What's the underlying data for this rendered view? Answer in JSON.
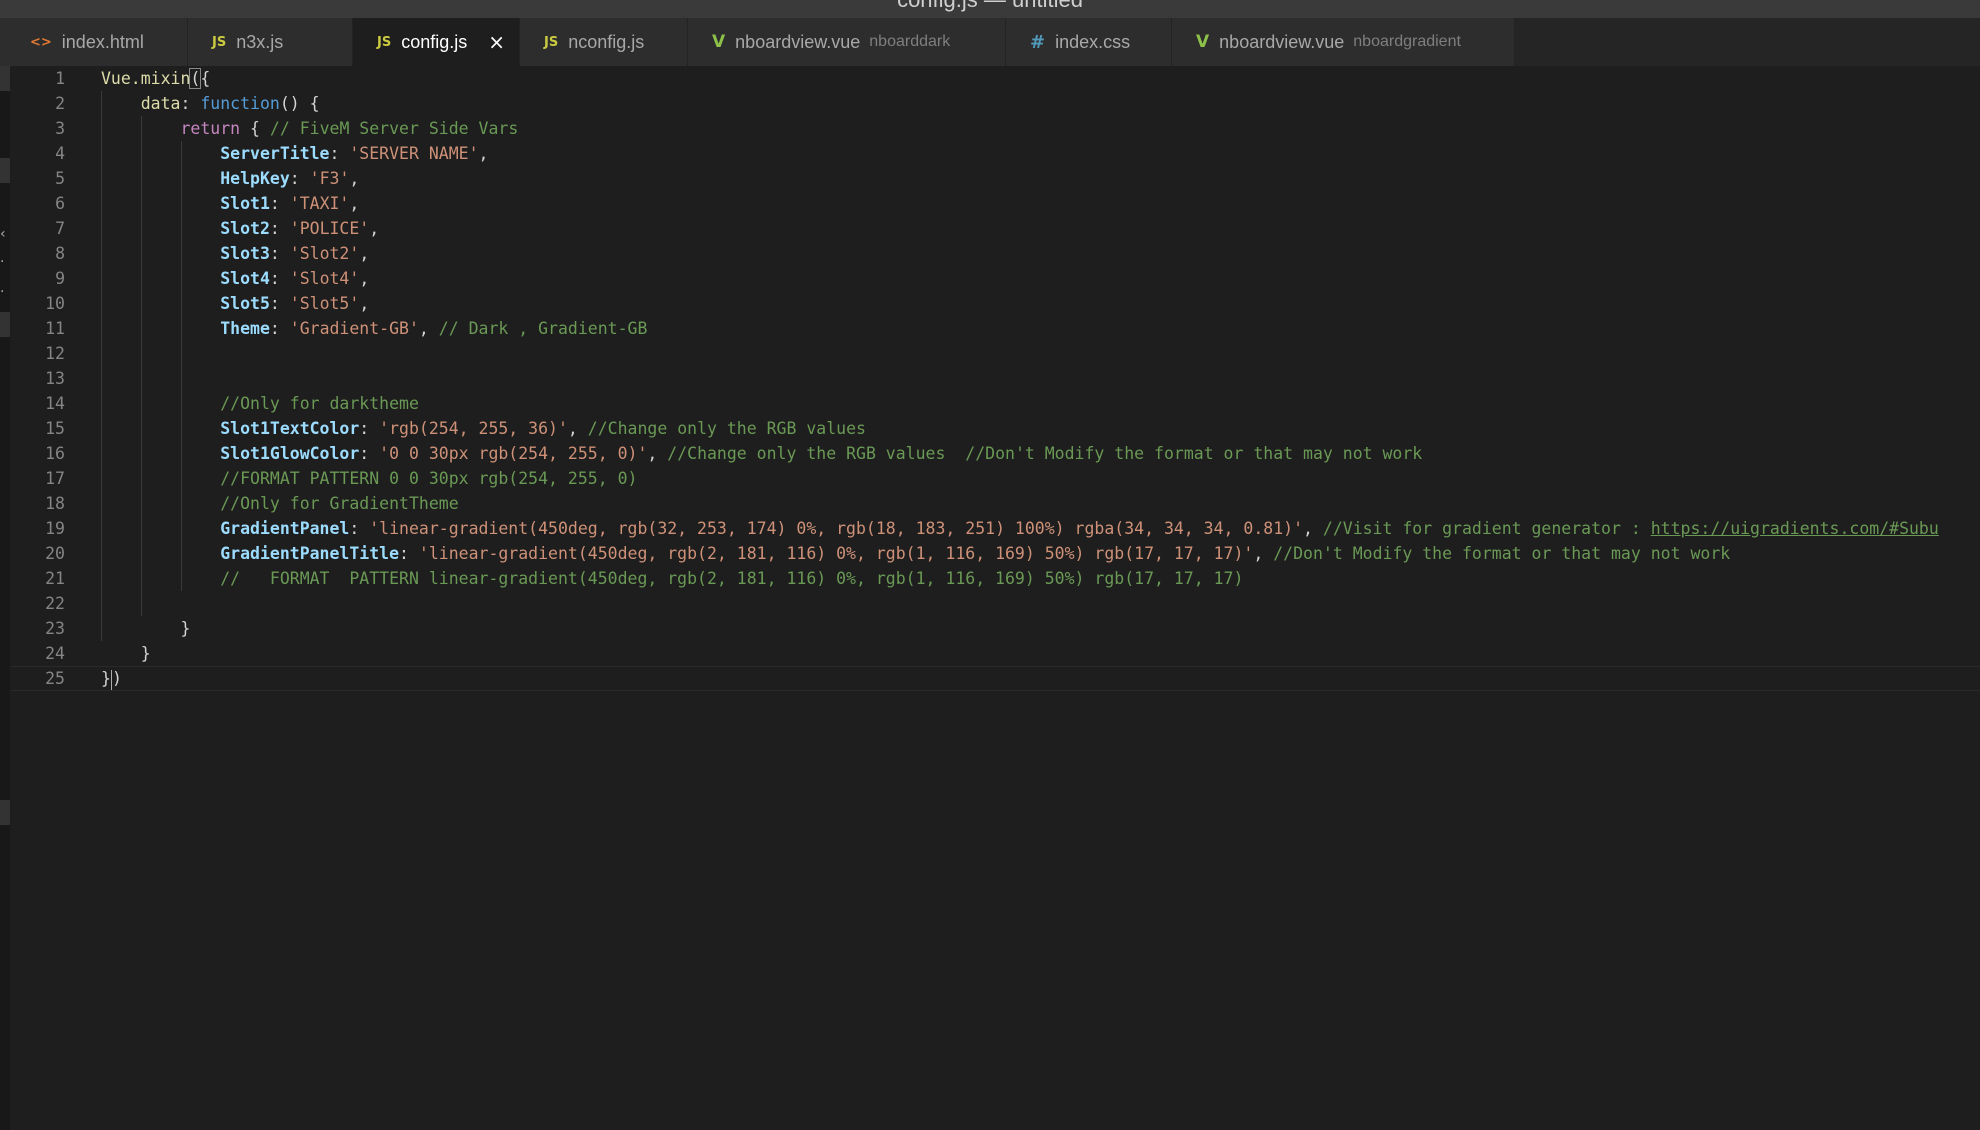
{
  "window": {
    "title": "config.js — untitled"
  },
  "tabs": [
    {
      "label": "index.html",
      "icon": "<>",
      "type": "html",
      "sub": "",
      "active": false
    },
    {
      "label": "n3x.js",
      "icon": "JS",
      "type": "js",
      "sub": "",
      "active": false
    },
    {
      "label": "config.js",
      "icon": "JS",
      "type": "js",
      "sub": "",
      "active": true,
      "close": "×"
    },
    {
      "label": "nconfig.js",
      "icon": "JS",
      "type": "js",
      "sub": "",
      "active": false
    },
    {
      "label": "nboardview.vue",
      "icon": "V",
      "type": "vue",
      "sub": "nboarddark",
      "active": false
    },
    {
      "label": "index.css",
      "icon": "#",
      "type": "css",
      "sub": "",
      "active": false
    },
    {
      "label": "nboardview.vue",
      "icon": "V",
      "type": "vue",
      "sub": "nboardgradient",
      "active": false
    }
  ],
  "editor": {
    "lines": [
      {
        "n": "1",
        "tokens": [
          [
            "id",
            "Vue.mixin"
          ],
          [
            "pun",
            "("
          ],
          [
            "pun",
            "{"
          ]
        ]
      },
      {
        "n": "2",
        "tokens": [
          [
            "pun",
            "    "
          ],
          [
            "id",
            "data"
          ],
          [
            "pun",
            ": "
          ],
          [
            "fn",
            "function"
          ],
          [
            "pun",
            "() {"
          ]
        ]
      },
      {
        "n": "3",
        "tokens": [
          [
            "pun",
            "        "
          ],
          [
            "kw",
            "return"
          ],
          [
            "pun",
            " { "
          ],
          [
            "cm",
            "// FiveM Server Side Vars"
          ]
        ]
      },
      {
        "n": "4",
        "tokens": [
          [
            "pun",
            "            "
          ],
          [
            "prop",
            "ServerTitle"
          ],
          [
            "pun",
            ": "
          ],
          [
            "str",
            "'SERVER NAME'"
          ],
          [
            "pun",
            ","
          ]
        ]
      },
      {
        "n": "5",
        "tokens": [
          [
            "pun",
            "            "
          ],
          [
            "prop",
            "HelpKey"
          ],
          [
            "pun",
            ": "
          ],
          [
            "str",
            "'F3'"
          ],
          [
            "pun",
            ","
          ]
        ]
      },
      {
        "n": "6",
        "tokens": [
          [
            "pun",
            "            "
          ],
          [
            "prop",
            "Slot1"
          ],
          [
            "pun",
            ": "
          ],
          [
            "str",
            "'TAXI'"
          ],
          [
            "pun",
            ","
          ]
        ]
      },
      {
        "n": "7",
        "tokens": [
          [
            "pun",
            "            "
          ],
          [
            "prop",
            "Slot2"
          ],
          [
            "pun",
            ": "
          ],
          [
            "str",
            "'POLICE'"
          ],
          [
            "pun",
            ","
          ]
        ]
      },
      {
        "n": "8",
        "tokens": [
          [
            "pun",
            "            "
          ],
          [
            "prop",
            "Slot3"
          ],
          [
            "pun",
            ": "
          ],
          [
            "str",
            "'Slot2'"
          ],
          [
            "pun",
            ","
          ]
        ]
      },
      {
        "n": "9",
        "tokens": [
          [
            "pun",
            "            "
          ],
          [
            "prop",
            "Slot4"
          ],
          [
            "pun",
            ": "
          ],
          [
            "str",
            "'Slot4'"
          ],
          [
            "pun",
            ","
          ]
        ]
      },
      {
        "n": "10",
        "tokens": [
          [
            "pun",
            "            "
          ],
          [
            "prop",
            "Slot5"
          ],
          [
            "pun",
            ": "
          ],
          [
            "str",
            "'Slot5'"
          ],
          [
            "pun",
            ","
          ]
        ]
      },
      {
        "n": "11",
        "tokens": [
          [
            "pun",
            "            "
          ],
          [
            "prop",
            "Theme"
          ],
          [
            "pun",
            ": "
          ],
          [
            "str",
            "'Gradient-GB'"
          ],
          [
            "pun",
            ", "
          ],
          [
            "cm",
            "// Dark , Gradient-GB"
          ]
        ]
      },
      {
        "n": "12",
        "tokens": []
      },
      {
        "n": "13",
        "tokens": []
      },
      {
        "n": "14",
        "tokens": [
          [
            "pun",
            "            "
          ],
          [
            "cm",
            "//Only for darktheme"
          ]
        ]
      },
      {
        "n": "15",
        "tokens": [
          [
            "pun",
            "            "
          ],
          [
            "prop",
            "Slot1TextColor"
          ],
          [
            "pun",
            ": "
          ],
          [
            "str",
            "'rgb(254, 255, 36)'"
          ],
          [
            "pun",
            ", "
          ],
          [
            "cm",
            "//Change only the RGB values"
          ]
        ]
      },
      {
        "n": "16",
        "tokens": [
          [
            "pun",
            "            "
          ],
          [
            "prop",
            "Slot1GlowColor"
          ],
          [
            "pun",
            ": "
          ],
          [
            "str",
            "'0 0 30px rgb(254, 255, 0)'"
          ],
          [
            "pun",
            ", "
          ],
          [
            "cm",
            "//Change only the RGB values  //Don't Modify the format or that may not work"
          ]
        ]
      },
      {
        "n": "17",
        "tokens": [
          [
            "pun",
            "            "
          ],
          [
            "cm",
            "//FORMAT PATTERN 0 0 30px rgb(254, 255, 0)"
          ]
        ]
      },
      {
        "n": "18",
        "tokens": [
          [
            "pun",
            "            "
          ],
          [
            "cm",
            "//Only for GradientTheme"
          ]
        ]
      },
      {
        "n": "19",
        "tokens": [
          [
            "pun",
            "            "
          ],
          [
            "prop",
            "GradientPanel"
          ],
          [
            "pun",
            ": "
          ],
          [
            "str",
            "'linear-gradient(450deg, rgb(32, 253, 174) 0%, rgb(18, 183, 251) 100%) rgba(34, 34, 34, 0.81)'"
          ],
          [
            "pun",
            ", "
          ],
          [
            "cm",
            "//Visit for gradient generator : "
          ],
          [
            "lnk",
            "https://uigradients.com/#Subu"
          ]
        ]
      },
      {
        "n": "20",
        "tokens": [
          [
            "pun",
            "            "
          ],
          [
            "prop",
            "GradientPanelTitle"
          ],
          [
            "pun",
            ": "
          ],
          [
            "str",
            "'linear-gradient(450deg, rgb(2, 181, 116) 0%, rgb(1, 116, 169) 50%) rgb(17, 17, 17)'"
          ],
          [
            "pun",
            ", "
          ],
          [
            "cm",
            "//Don't Modify the format or that may not work"
          ]
        ]
      },
      {
        "n": "21",
        "tokens": [
          [
            "pun",
            "            "
          ],
          [
            "cm",
            "//   FORMAT  PATTERN linear-gradient(450deg, rgb(2, 181, 116) 0%, rgb(1, 116, 169) 50%) rgb(17, 17, 17)"
          ]
        ]
      },
      {
        "n": "22",
        "tokens": []
      },
      {
        "n": "23",
        "tokens": [
          [
            "pun",
            "        }"
          ]
        ]
      },
      {
        "n": "24",
        "tokens": [
          [
            "pun",
            "    }"
          ]
        ]
      },
      {
        "n": "25",
        "tokens": [
          [
            "pun",
            "}"
          ],
          [
            "caret",
            ""
          ],
          [
            "pun",
            ")"
          ]
        ]
      }
    ]
  }
}
